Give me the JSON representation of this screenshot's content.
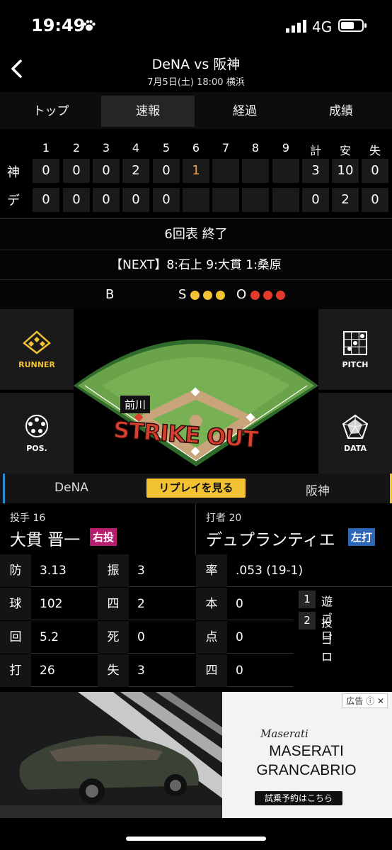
{
  "status": {
    "time": "19:49",
    "network": "4G"
  },
  "header": {
    "title": "DeNA vs 阪神",
    "subtitle": "7月5日(土) 18:00 横浜"
  },
  "tabs": [
    "トップ",
    "速報",
    "経過",
    "成績"
  ],
  "scoreboard": {
    "columns": [
      "1",
      "2",
      "3",
      "4",
      "5",
      "6",
      "7",
      "8",
      "9",
      "計",
      "安",
      "失"
    ],
    "rows": [
      {
        "team": "神",
        "cells": [
          "0",
          "0",
          "0",
          "2",
          "0",
          "1",
          "",
          "",
          "",
          "3",
          "10",
          "0"
        ]
      },
      {
        "team": "デ",
        "cells": [
          "0",
          "0",
          "0",
          "0",
          "0",
          "",
          "",
          "",
          "",
          "0",
          "2",
          "0"
        ]
      }
    ]
  },
  "inning_status": "6回表 終了",
  "next_batters": "【NEXT】8:石上 9:大貫 1:桑原",
  "count": {
    "b_label": "B",
    "s_label": "S",
    "o_label": "O",
    "balls": 0,
    "strikes": 3,
    "outs": 3
  },
  "field": {
    "runner_label": "RUNNER",
    "pitch_label": "PITCH",
    "pos_label": "POS.",
    "data_label": "DATA",
    "player_tag": "前川",
    "overlay": "STRIKE OUT"
  },
  "team_switch": {
    "left": "DeNA",
    "replay": "リプレイを見る",
    "right": "阪神"
  },
  "pitcher": {
    "role": "投手 16",
    "name": "大貫 晋一",
    "hand": "右投",
    "stats": [
      {
        "k1": "防",
        "v1": "3.13",
        "k2": "振",
        "v2": "3"
      },
      {
        "k1": "球",
        "v1": "102",
        "k2": "四",
        "v2": "2"
      },
      {
        "k1": "回",
        "v1": "5.2",
        "k2": "死",
        "v2": "0"
      },
      {
        "k1": "打",
        "v1": "26",
        "k2": "失",
        "v2": "3"
      }
    ]
  },
  "batter": {
    "role": "打者 20",
    "name": "デュプランティエ",
    "hand": "左打",
    "stats": [
      {
        "k": "率",
        "v": ".053 (19-1)"
      },
      {
        "k": "本",
        "v": "0"
      },
      {
        "k": "点",
        "v": "0"
      },
      {
        "k": "四",
        "v": "0"
      }
    ],
    "at_bats": [
      {
        "n": "1",
        "result": "遊ゴロ"
      },
      {
        "n": "2",
        "result": "投ゴロ"
      }
    ]
  },
  "ad": {
    "tag": "広告",
    "logo": "Maserati",
    "line1": "MASERATI",
    "line2": "GRANCABRIO",
    "cta": "試乗予約はこちら"
  }
}
